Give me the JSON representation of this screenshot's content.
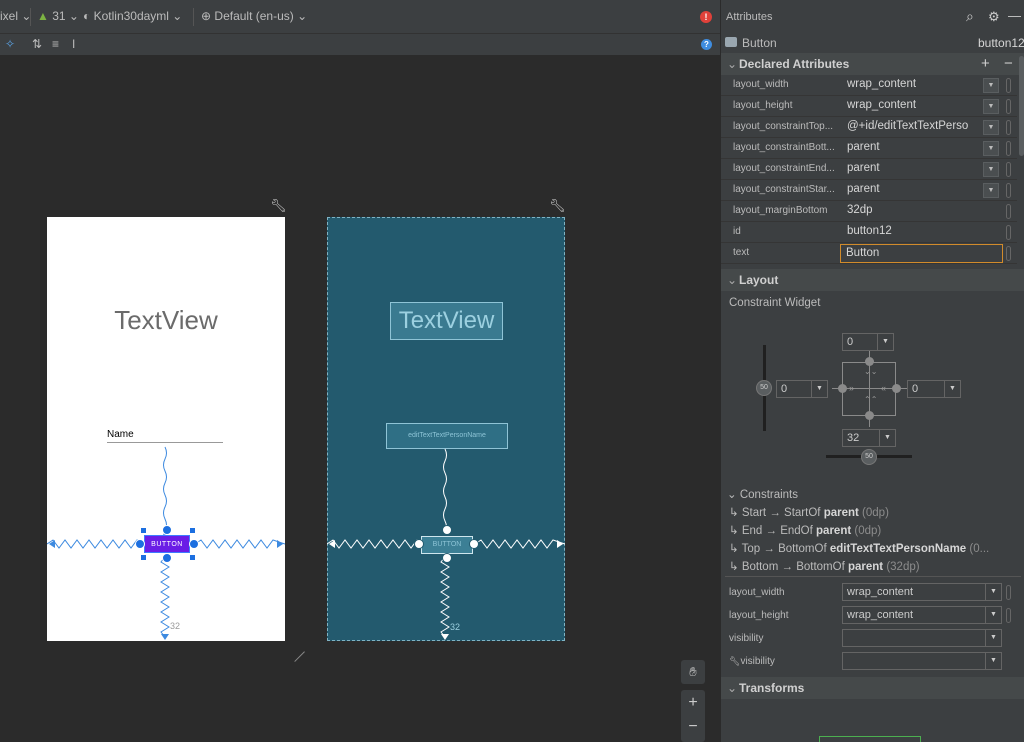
{
  "toolbar": {
    "device": "ixel",
    "api": "31",
    "theme": "Kotlin30dayml",
    "locale": "Default (en-us)"
  },
  "canvas": {
    "textview_label": "TextView",
    "name_hint": "Name",
    "edittext_id": "editTextTextPersonName",
    "button_label": "BUTTON",
    "margin_bottom": "32"
  },
  "panel": {
    "title": "Attributes",
    "component_type": "Button",
    "component_id": "button12",
    "declared_header": "Declared Attributes",
    "declared": [
      {
        "key": "layout_width",
        "value": "wrap_content"
      },
      {
        "key": "layout_height",
        "value": "wrap_content"
      },
      {
        "key": "layout_constraintTop...",
        "value": "@+id/editTextTextPerso"
      },
      {
        "key": "layout_constraintBott...",
        "value": "parent"
      },
      {
        "key": "layout_constraintEnd...",
        "value": "parent"
      },
      {
        "key": "layout_constraintStar...",
        "value": "parent"
      },
      {
        "key": "layout_marginBottom",
        "value": "32dp"
      },
      {
        "key": "id",
        "value": "button12"
      },
      {
        "key": "text",
        "value": "Button"
      }
    ],
    "layout_header": "Layout",
    "constraint_widget_label": "Constraint Widget",
    "widget": {
      "top": "0",
      "left": "0",
      "right": "0",
      "bottom": "32",
      "bias_v": "50",
      "bias_h": "50"
    },
    "constraints_header": "Constraints",
    "constraints": [
      {
        "a": "Start",
        "b": "StartOf",
        "target": "parent",
        "margin": "(0dp)"
      },
      {
        "a": "End",
        "b": "EndOf",
        "target": "parent",
        "margin": "(0dp)"
      },
      {
        "a": "Top",
        "b": "BottomOf",
        "target": "editTextTextPersonName",
        "margin": "(0..."
      },
      {
        "a": "Bottom",
        "b": "BottomOf",
        "target": "parent",
        "margin": "(32dp)"
      }
    ],
    "layout_attrs": [
      {
        "key": "layout_width",
        "value": "wrap_content"
      },
      {
        "key": "layout_height",
        "value": "wrap_content"
      },
      {
        "key": "visibility",
        "value": ""
      },
      {
        "key": "visibility",
        "value": ""
      }
    ],
    "transforms_header": "Transforms"
  },
  "arrow": "→",
  "icons": {
    "error": "error-icon",
    "help": "help-icon"
  }
}
